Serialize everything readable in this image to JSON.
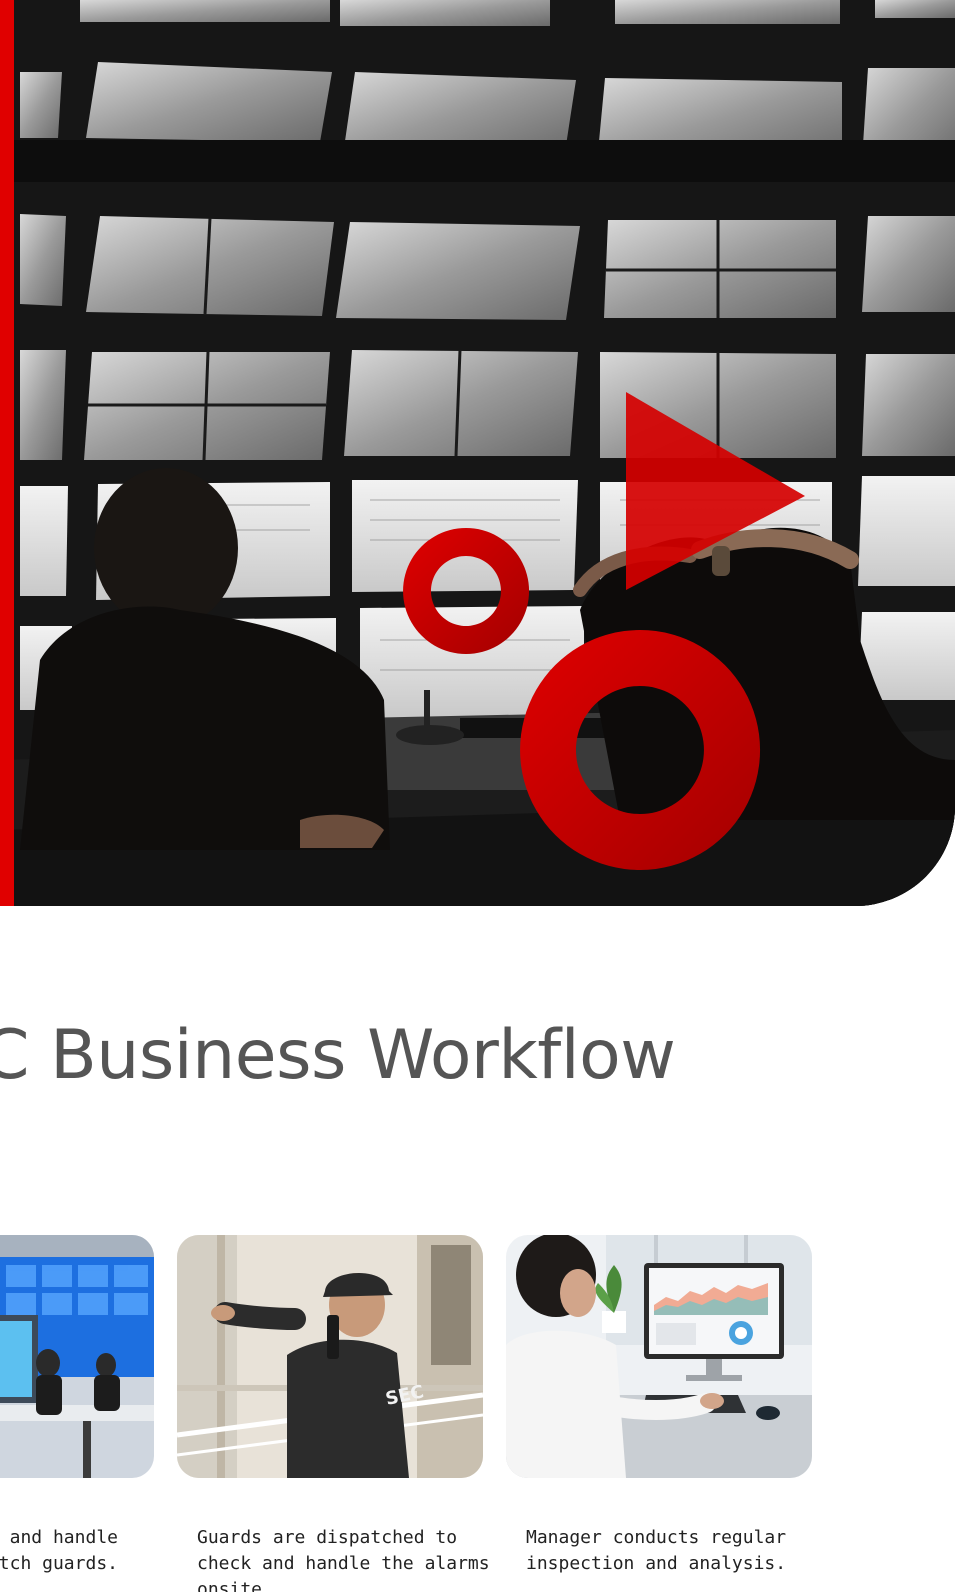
{
  "hero": {
    "accent_color": "#e00000",
    "shapes": [
      "triangle-play-shape",
      "small-ring-shape",
      "large-ring-shape"
    ]
  },
  "section": {
    "title": "C Business Workflow"
  },
  "workflow_steps": [
    {
      "image": "control-room-monitors-photo",
      "text": "y and handle\npatch guards."
    },
    {
      "image": "security-guard-radio-photo",
      "text": "Guards are dispatched to\ncheck and handle the alarms\nonsite."
    },
    {
      "image": "manager-dashboard-photo",
      "text": "Manager conducts regular\ninspection and analysis."
    }
  ],
  "colors": {
    "heading": "#555555",
    "body_text": "#222222",
    "accent": "#e00000"
  }
}
